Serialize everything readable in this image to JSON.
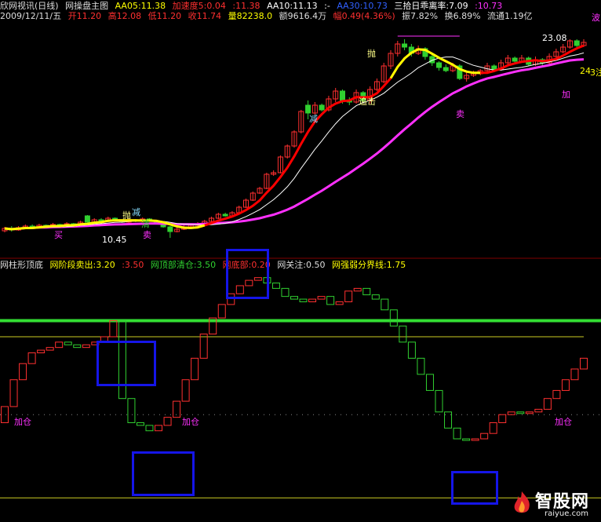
{
  "header": {
    "title": "欣网视讯(日线)",
    "panel_name": "网操盘主图",
    "aa05": "AA05:11.38",
    "speed": "加速度5:0.04",
    "v1": ":11.38",
    "aa10": "AA10:11.13",
    "v2": ":-",
    "aa30": "AA30:10.73",
    "deviation": "三拾日乖离率:7.09",
    "v3": ":10.73"
  },
  "quote": {
    "date": "2009/12/11/五",
    "open": "开11.20",
    "high": "高12.08",
    "low": "低11.20",
    "close": "收11.74",
    "volume": "量82238.0",
    "amount": "额9616.4万",
    "change": "幅0.49(4.36%)",
    "amplitude": "振7.82%",
    "turnover": "换6.89%",
    "float": "流通1.19亿"
  },
  "upper_annotations": {
    "high_price": "23.08",
    "low_price": "10.45",
    "cut": "减",
    "chase": "追击",
    "sell": "卖",
    "add": "加",
    "buy": "买",
    "throw": "抛",
    "clear": "清",
    "edge_left": "24",
    "edge_right": "3注",
    "edge_top": "波"
  },
  "indicator": {
    "name": "网柱形顶底",
    "stage_sell": "网阶段卖出:3.20",
    "v1": ":3.50",
    "top_clear": "网顶部清仓:3.50",
    "bottom": "网底部:0.20",
    "watch": "网关注:0.50",
    "strength": "网强弱分界线:1.75",
    "add_label": "加仓"
  },
  "watermark": {
    "brand": "智股网",
    "url": "raiyue.com"
  },
  "colors": {
    "up": "#ff3030",
    "down": "#30d030",
    "ma5": "#ffff00",
    "ma10": "#ffffff",
    "ma_red": "#ff0000",
    "ma30": "#ff30ff",
    "threshold_green": "#33dd33",
    "threshold_yellow": "#cccc22",
    "box_blue": "#1515e8"
  },
  "bars": [
    {
      "o": 10.9,
      "c": 11.05,
      "h": 11.15,
      "l": 10.8
    },
    {
      "o": 11.05,
      "c": 10.95,
      "h": 11.2,
      "l": 10.85
    },
    {
      "o": 10.95,
      "c": 11.1,
      "h": 11.2,
      "l": 10.9
    },
    {
      "o": 11.1,
      "c": 11.2,
      "h": 11.3,
      "l": 11.0
    },
    {
      "o": 11.2,
      "c": 11.1,
      "h": 11.3,
      "l": 11.0
    },
    {
      "o": 11.1,
      "c": 11.25,
      "h": 11.35,
      "l": 11.05
    },
    {
      "o": 11.25,
      "c": 11.15,
      "h": 11.3,
      "l": 11.05
    },
    {
      "o": 11.15,
      "c": 11.3,
      "h": 11.4,
      "l": 11.1
    },
    {
      "o": 11.3,
      "c": 11.2,
      "h": 11.35,
      "l": 11.1
    },
    {
      "o": 11.2,
      "c": 11.35,
      "h": 11.45,
      "l": 11.15
    },
    {
      "o": 11.35,
      "c": 11.25,
      "h": 11.4,
      "l": 11.15
    },
    {
      "o": 11.25,
      "c": 11.45,
      "h": 11.55,
      "l": 11.2
    },
    {
      "o": 11.85,
      "c": 11.45,
      "h": 11.9,
      "l": 11.4
    },
    {
      "o": 11.45,
      "c": 11.6,
      "h": 11.7,
      "l": 11.4
    },
    {
      "o": 11.6,
      "c": 11.5,
      "h": 11.7,
      "l": 11.4
    },
    {
      "o": 11.5,
      "c": 11.7,
      "h": 11.8,
      "l": 11.45
    },
    {
      "o": 11.7,
      "c": 11.55,
      "h": 11.75,
      "l": 11.5
    },
    {
      "o": 11.55,
      "c": 11.45,
      "h": 11.6,
      "l": 11.4
    },
    {
      "o": 11.45,
      "c": 11.6,
      "h": 11.7,
      "l": 11.4
    },
    {
      "o": 11.6,
      "c": 11.5,
      "h": 11.65,
      "l": 11.45
    },
    {
      "o": 11.5,
      "c": 11.65,
      "h": 11.75,
      "l": 11.45
    },
    {
      "o": 11.65,
      "c": 11.55,
      "h": 11.7,
      "l": 11.5
    },
    {
      "o": 11.55,
      "c": 11.35,
      "h": 11.6,
      "l": 11.3
    },
    {
      "o": 11.35,
      "c": 11.15,
      "h": 11.4,
      "l": 11.1
    },
    {
      "o": 11.15,
      "c": 10.85,
      "h": 11.2,
      "l": 10.45
    },
    {
      "o": 10.85,
      "c": 11.0,
      "h": 11.1,
      "l": 10.8
    },
    {
      "o": 11.0,
      "c": 11.15,
      "h": 11.25,
      "l": 10.95
    },
    {
      "o": 11.15,
      "c": 11.25,
      "h": 11.35,
      "l": 11.1
    },
    {
      "o": 11.25,
      "c": 11.35,
      "h": 11.45,
      "l": 11.2
    },
    {
      "o": 11.35,
      "c": 11.5,
      "h": 11.6,
      "l": 11.3
    },
    {
      "o": 11.5,
      "c": 11.7,
      "h": 11.8,
      "l": 11.45
    },
    {
      "o": 11.7,
      "c": 11.95,
      "h": 12.05,
      "l": 11.65
    },
    {
      "o": 11.95,
      "c": 11.85,
      "h": 12.05,
      "l": 11.8
    },
    {
      "o": 11.85,
      "c": 12.05,
      "h": 12.15,
      "l": 11.8
    },
    {
      "o": 12.05,
      "c": 12.4,
      "h": 12.5,
      "l": 12.0
    },
    {
      "o": 12.4,
      "c": 12.85,
      "h": 12.95,
      "l": 12.35
    },
    {
      "o": 12.85,
      "c": 13.3,
      "h": 13.4,
      "l": 12.8
    },
    {
      "o": 13.3,
      "c": 13.6,
      "h": 13.7,
      "l": 13.25
    },
    {
      "o": 13.6,
      "c": 14.5,
      "h": 14.6,
      "l": 13.55
    },
    {
      "o": 14.5,
      "c": 14.6,
      "h": 14.75,
      "l": 14.4
    },
    {
      "o": 14.6,
      "c": 15.6,
      "h": 15.7,
      "l": 14.55
    },
    {
      "o": 15.6,
      "c": 16.3,
      "h": 16.4,
      "l": 15.5
    },
    {
      "o": 16.3,
      "c": 17.2,
      "h": 17.3,
      "l": 16.2
    },
    {
      "o": 17.2,
      "c": 18.5,
      "h": 18.6,
      "l": 17.1
    },
    {
      "o": 18.9,
      "c": 18.4,
      "h": 19.2,
      "l": 18.0
    },
    {
      "o": 18.4,
      "c": 18.9,
      "h": 19.1,
      "l": 18.3
    },
    {
      "o": 18.9,
      "c": 18.6,
      "h": 19.0,
      "l": 18.5
    },
    {
      "o": 18.6,
      "c": 19.3,
      "h": 19.5,
      "l": 18.5
    },
    {
      "o": 19.3,
      "c": 19.8,
      "h": 20.0,
      "l": 19.1
    },
    {
      "o": 19.8,
      "c": 19.2,
      "h": 19.9,
      "l": 19.0
    },
    {
      "o": 19.2,
      "c": 19.1,
      "h": 19.4,
      "l": 18.9
    },
    {
      "o": 19.1,
      "c": 19.7,
      "h": 19.9,
      "l": 19.0
    },
    {
      "o": 19.7,
      "c": 19.2,
      "h": 19.8,
      "l": 19.1
    },
    {
      "o": 19.2,
      "c": 19.9,
      "h": 20.1,
      "l": 19.0
    },
    {
      "o": 19.9,
      "c": 20.4,
      "h": 20.6,
      "l": 19.8
    },
    {
      "o": 20.4,
      "c": 21.4,
      "h": 21.6,
      "l": 20.3
    },
    {
      "o": 21.4,
      "c": 22.2,
      "h": 22.4,
      "l": 21.2
    },
    {
      "o": 22.2,
      "c": 22.8,
      "h": 23.0,
      "l": 22.0
    },
    {
      "o": 22.8,
      "c": 22.6,
      "h": 23.1,
      "l": 22.4
    },
    {
      "o": 22.6,
      "c": 22.2,
      "h": 22.8,
      "l": 22.0
    },
    {
      "o": 22.2,
      "c": 22.5,
      "h": 22.7,
      "l": 22.1
    },
    {
      "o": 22.5,
      "c": 22.0,
      "h": 22.6,
      "l": 21.8
    },
    {
      "o": 22.0,
      "c": 21.6,
      "h": 22.1,
      "l": 21.4
    },
    {
      "o": 21.6,
      "c": 21.3,
      "h": 21.7,
      "l": 21.1
    },
    {
      "o": 21.3,
      "c": 21.1,
      "h": 21.5,
      "l": 21.0
    },
    {
      "o": 21.1,
      "c": 21.4,
      "h": 21.6,
      "l": 21.0
    },
    {
      "o": 21.4,
      "c": 20.6,
      "h": 21.5,
      "l": 20.5
    },
    {
      "o": 20.6,
      "c": 20.8,
      "h": 21.0,
      "l": 20.4
    },
    {
      "o": 20.8,
      "c": 20.9,
      "h": 21.1,
      "l": 20.7
    },
    {
      "o": 20.9,
      "c": 21.1,
      "h": 21.2,
      "l": 20.8
    },
    {
      "o": 21.1,
      "c": 21.4,
      "h": 21.6,
      "l": 21.0
    },
    {
      "o": 21.4,
      "c": 21.2,
      "h": 21.5,
      "l": 21.0
    },
    {
      "o": 21.2,
      "c": 21.6,
      "h": 21.8,
      "l": 21.1
    },
    {
      "o": 21.6,
      "c": 21.9,
      "h": 22.1,
      "l": 21.5
    },
    {
      "o": 21.9,
      "c": 21.7,
      "h": 22.0,
      "l": 21.5
    },
    {
      "o": 21.7,
      "c": 21.9,
      "h": 22.1,
      "l": 21.6
    },
    {
      "o": 21.9,
      "c": 21.5,
      "h": 22.0,
      "l": 21.4
    },
    {
      "o": 21.5,
      "c": 21.8,
      "h": 22.0,
      "l": 21.4
    },
    {
      "o": 21.8,
      "c": 21.6,
      "h": 21.9,
      "l": 21.4
    },
    {
      "o": 21.6,
      "c": 22.0,
      "h": 22.2,
      "l": 21.5
    },
    {
      "o": 22.0,
      "c": 22.3,
      "h": 22.5,
      "l": 21.9
    },
    {
      "o": 22.3,
      "c": 22.6,
      "h": 22.8,
      "l": 22.2
    },
    {
      "o": 22.6,
      "c": 23.0,
      "h": 23.1,
      "l": 22.5
    },
    {
      "o": 23.0,
      "c": 22.7,
      "h": 23.1,
      "l": 22.5
    },
    {
      "o": 22.7,
      "c": 22.9,
      "h": 23.1,
      "l": 22.6
    }
  ],
  "indicator_bars": [
    1.9,
    2.4,
    2.7,
    2.9,
    2.95,
    3.0,
    3.1,
    3.05,
    3.0,
    3.05,
    3.1,
    3.2,
    3.5,
    2.05,
    1.6,
    1.55,
    1.45,
    1.55,
    1.7,
    2.0,
    2.4,
    2.8,
    3.25,
    3.55,
    3.8,
    4.0,
    4.15,
    4.25,
    4.3,
    4.2,
    4.1,
    3.95,
    3.9,
    3.85,
    3.9,
    3.95,
    3.8,
    3.85,
    4.05,
    4.1,
    3.98,
    3.9,
    3.7,
    3.4,
    3.1,
    2.8,
    2.5,
    2.2,
    1.8,
    1.5,
    1.3,
    1.28,
    1.3,
    1.4,
    1.6,
    1.75,
    1.8,
    1.78,
    1.8,
    1.85,
    2.05,
    2.2,
    2.4,
    2.6,
    2.8
  ]
}
